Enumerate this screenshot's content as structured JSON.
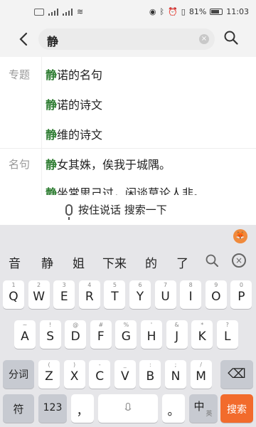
{
  "status": {
    "battery": "81%",
    "time": "11:03"
  },
  "search": {
    "query": "静",
    "clear_label": "×"
  },
  "results": {
    "label_topic": "专题",
    "label_quote": "名句",
    "topic_items": [
      {
        "hl": "静",
        "rest": "诺的名句"
      },
      {
        "hl": "静",
        "rest": "诺的诗文"
      },
      {
        "hl": "静",
        "rest": "维的诗文"
      }
    ],
    "quote_items": [
      {
        "hl": "静",
        "rest": "女其姝，俟我于城隅。"
      },
      {
        "hl": "静",
        "rest": "坐常思己过，闲谈莫论人非。"
      }
    ]
  },
  "voice": {
    "label": "按住说话 搜索一下"
  },
  "keyboard": {
    "candidates": [
      "音",
      "静",
      "姐",
      "下来",
      "的",
      "了"
    ],
    "row1": [
      {
        "m": "Q",
        "s": "1"
      },
      {
        "m": "W",
        "s": "2"
      },
      {
        "m": "E",
        "s": "3"
      },
      {
        "m": "R",
        "s": "4"
      },
      {
        "m": "T",
        "s": "5"
      },
      {
        "m": "Y",
        "s": "6"
      },
      {
        "m": "U",
        "s": "7"
      },
      {
        "m": "I",
        "s": "8"
      },
      {
        "m": "O",
        "s": "9"
      },
      {
        "m": "P",
        "s": "0"
      }
    ],
    "row2": [
      {
        "m": "A",
        "s": "~"
      },
      {
        "m": "S",
        "s": "!"
      },
      {
        "m": "D",
        "s": "@"
      },
      {
        "m": "F",
        "s": "#"
      },
      {
        "m": "G",
        "s": "%"
      },
      {
        "m": "H",
        "s": "'"
      },
      {
        "m": "J",
        "s": "&"
      },
      {
        "m": "K",
        "s": "*"
      },
      {
        "m": "L",
        "s": "?"
      }
    ],
    "row3": [
      {
        "m": "Z",
        "s": "("
      },
      {
        "m": "X",
        "s": ")"
      },
      {
        "m": "C",
        "s": "-"
      },
      {
        "m": "V",
        "s": "_"
      },
      {
        "m": "B",
        "s": ":"
      },
      {
        "m": "N",
        "s": ";"
      },
      {
        "m": "M",
        "s": "/"
      }
    ],
    "fenci": "分词",
    "fu": "符",
    "num": "123",
    "comma": "，",
    "period": "。",
    "zhong": "中",
    "zhong_sub": "英",
    "search_key": "搜索",
    "backspace": "⌫",
    "fox": "🦊"
  },
  "colors": {
    "highlight": "#2e7d32",
    "search_key": "#f26b2c"
  }
}
